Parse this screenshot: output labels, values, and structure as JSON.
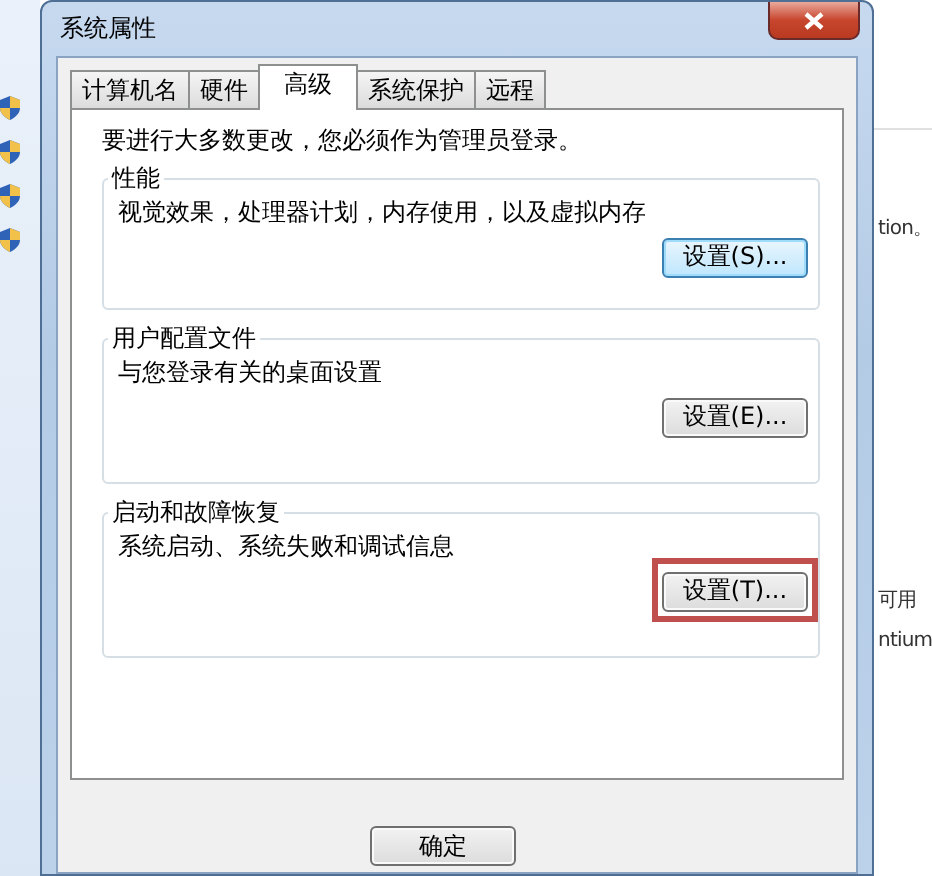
{
  "window": {
    "title": "系统属性"
  },
  "tabs": [
    {
      "label": "计算机名",
      "selected": false
    },
    {
      "label": "硬件",
      "selected": false
    },
    {
      "label": "高级",
      "selected": true
    },
    {
      "label": "系统保护",
      "selected": false
    },
    {
      "label": "远程",
      "selected": false
    }
  ],
  "notice": "要进行大多数更改，您必须作为管理员登录。",
  "groups": [
    {
      "title": "性能",
      "description": "视觉效果，处理器计划，内存使用，以及虚拟内存",
      "button": {
        "label": "设置(S)...",
        "focused": true,
        "highlighted": false
      }
    },
    {
      "title": "用户配置文件",
      "description": "与您登录有关的桌面设置",
      "button": {
        "label": "设置(E)...",
        "focused": false,
        "highlighted": false
      }
    },
    {
      "title": "启动和故障恢复",
      "description": "系统启动、系统失败和调试信息",
      "button": {
        "label": "设置(T)...",
        "focused": false,
        "highlighted": true
      }
    }
  ],
  "footer_buttons": [
    "确定"
  ],
  "background_window": {
    "right_texts": [
      "tion。",
      "可用",
      "ntium"
    ]
  }
}
